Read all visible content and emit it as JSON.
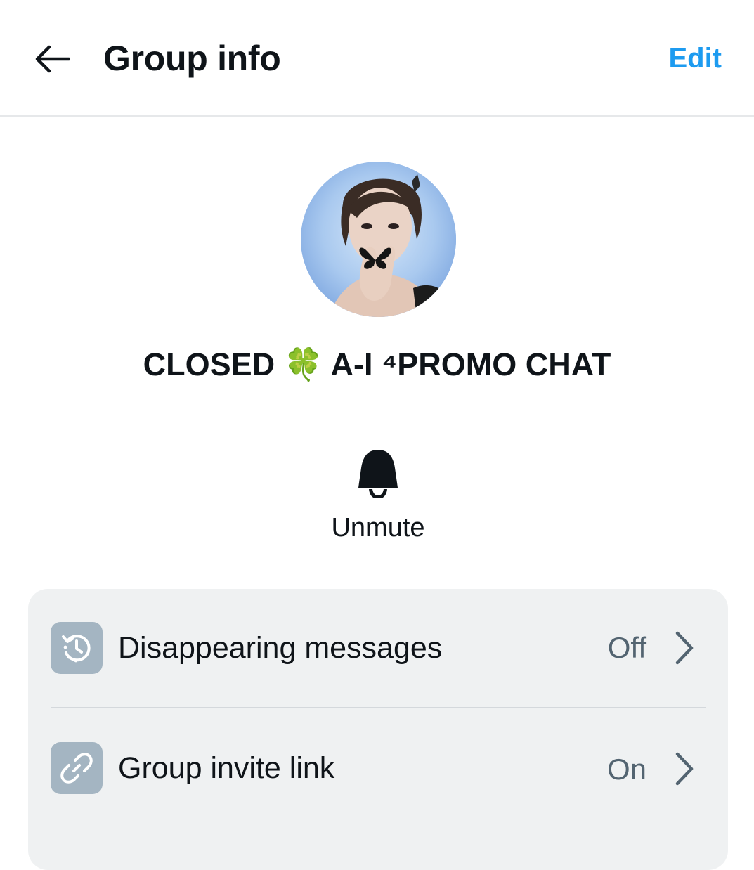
{
  "header": {
    "title": "Group info",
    "edit_label": "Edit",
    "back_icon": "arrow-left-icon"
  },
  "group": {
    "name": "CLOSED 🍀 A-I ⁴PROMO CHAT",
    "avatar": "group-avatar-photo"
  },
  "actions": {
    "mute": {
      "label": "Unmute",
      "icon": "bell-icon"
    }
  },
  "settings": {
    "rows": [
      {
        "label": "Disappearing messages",
        "value": "Off",
        "icon": "timer-history-icon"
      },
      {
        "label": "Group invite link",
        "value": "On",
        "icon": "link-icon"
      }
    ]
  },
  "colors": {
    "accent": "#1d9bf0",
    "text_primary": "#0f1419",
    "text_secondary": "#536471",
    "card_background": "#eff1f2",
    "icon_box": "#a4b5c2"
  }
}
